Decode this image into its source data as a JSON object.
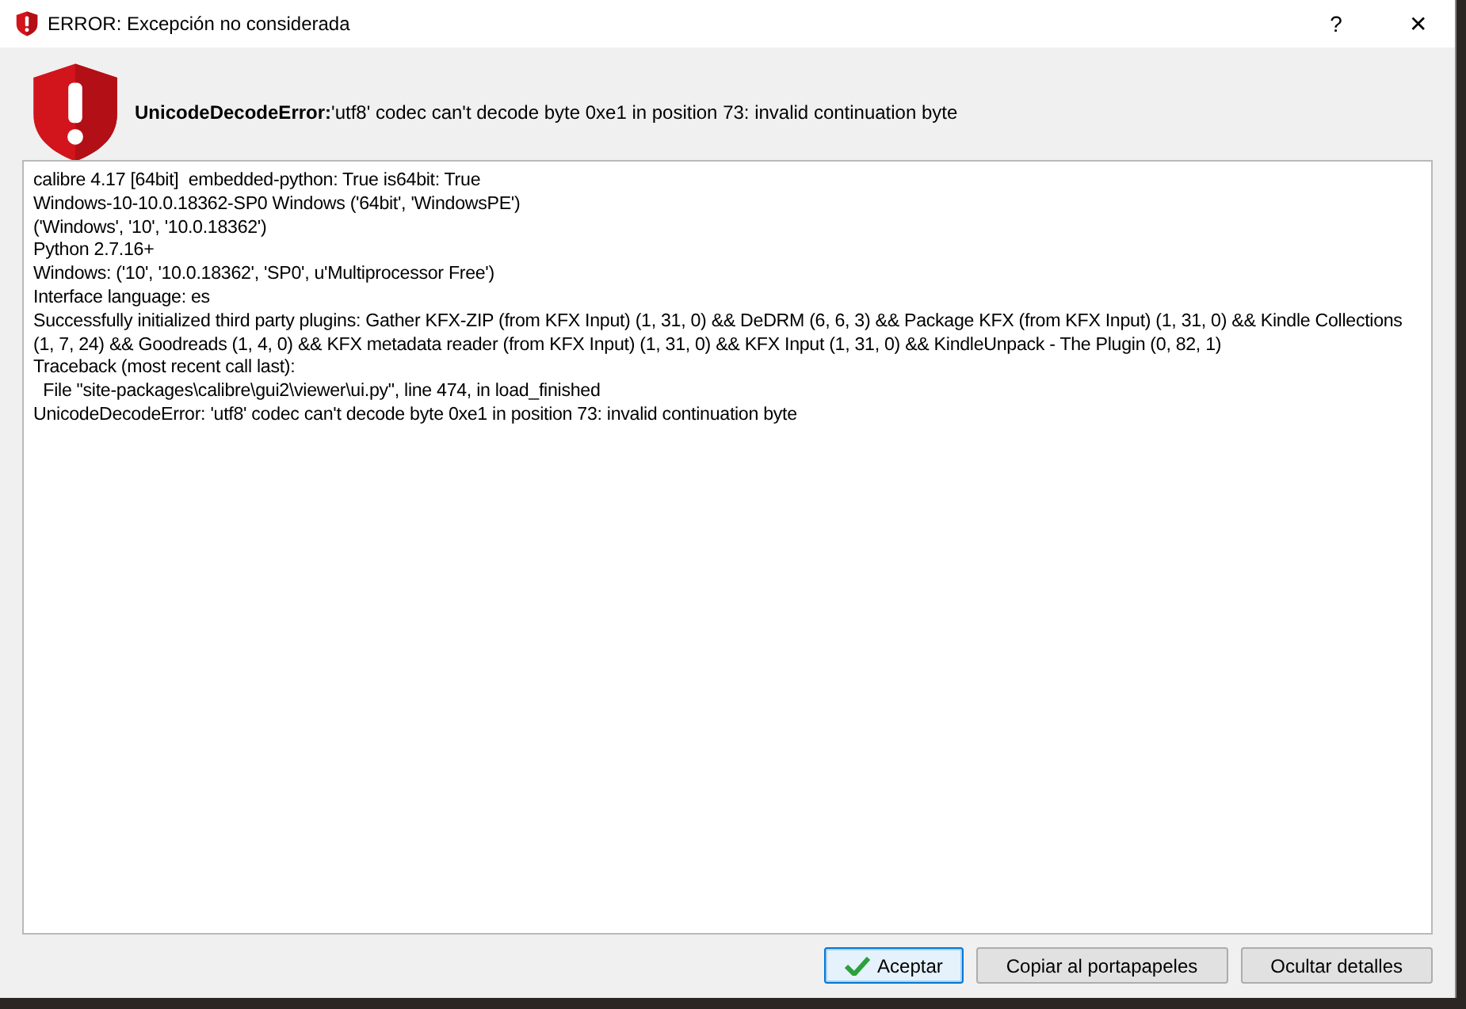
{
  "window": {
    "title": "ERROR: Excepción no considerada",
    "help": "?",
    "close": "✕"
  },
  "message": "**UnicodeDecodeError:**'utf8' codec can't decode byte 0xe1 in position 73: invalid continuation byte",
  "details": [
    "calibre 4.17 [64bit]  embedded-python: True is64bit: True",
    "Windows-10-10.0.18362-SP0 Windows ('64bit', 'WindowsPE')",
    "('Windows', '10', '10.0.18362')",
    "Python 2.7.16+",
    "Windows: ('10', '10.0.18362', 'SP0', u'Multiprocessor Free')",
    "Interface language: es",
    "Successfully initialized third party plugins: Gather KFX-ZIP (from KFX Input) (1, 31, 0) && DeDRM (6, 6, 3) && Package KFX (from KFX Input) (1, 31, 0) && Kindle Collections (1, 7, 24) && Goodreads (1, 4, 0) && KFX metadata reader (from KFX Input) (1, 31, 0) && KFX Input (1, 31, 0) && KindleUnpack - The Plugin (0, 82, 1)",
    "Traceback (most recent call last):",
    "  File \"site-packages\\calibre\\gui2\\viewer\\ui.py\", line 474, in load_finished",
    "UnicodeDecodeError: 'utf8' codec can't decode byte 0xe1 in position 73: invalid continuation byte"
  ],
  "buttons": [
    {
      "label": "Aceptar",
      "kind": "ok",
      "default": true
    },
    {
      "label": "Copiar al portapapeles",
      "kind": "copy",
      "default": false
    },
    {
      "label": "Ocultar detalles",
      "kind": "toggle",
      "default": false
    }
  ]
}
